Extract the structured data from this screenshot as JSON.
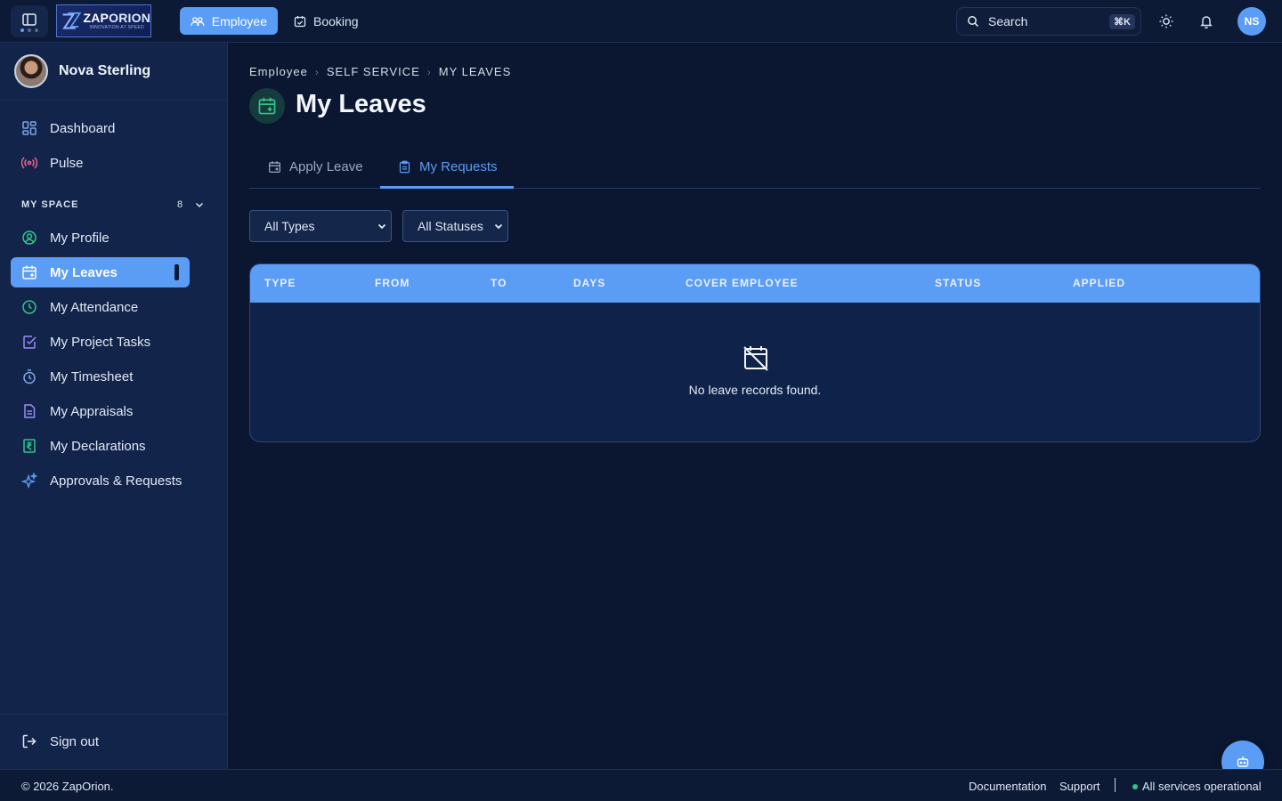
{
  "header": {
    "logo": {
      "name_bold": "ZAP",
      "name_rest": "ORION",
      "tagline": "INNOVATION AT SPEED"
    },
    "nav_tabs": [
      {
        "label": "Employee",
        "icon": "users-icon",
        "active": true
      },
      {
        "label": "Booking",
        "icon": "calendar-check-icon",
        "active": false
      }
    ],
    "search": {
      "placeholder": "Search",
      "shortcut": "⌘K"
    },
    "user_initials": "NS"
  },
  "sidebar": {
    "user_name": "Nova Sterling",
    "items": [
      {
        "label": "Dashboard",
        "icon": "dashboard-icon"
      },
      {
        "label": "Pulse",
        "icon": "broadcast-icon"
      }
    ],
    "section": {
      "label": "MY SPACE",
      "count": "8"
    },
    "space_items": [
      {
        "label": "My Profile",
        "icon": "user-circle-icon"
      },
      {
        "label": "My Leaves",
        "icon": "calendar-plus-icon",
        "active": true
      },
      {
        "label": "My Attendance",
        "icon": "clock-icon"
      },
      {
        "label": "My Project Tasks",
        "icon": "check-square-icon"
      },
      {
        "label": "My Timesheet",
        "icon": "timer-icon"
      },
      {
        "label": "My Appraisals",
        "icon": "document-icon"
      },
      {
        "label": "My Declarations",
        "icon": "rupee-receipt-icon"
      },
      {
        "label": "Approvals & Requests",
        "icon": "sparkles-icon"
      }
    ],
    "sign_out": "Sign out"
  },
  "main": {
    "breadcrumb": [
      "Employee",
      "SELF SERVICE",
      "MY LEAVES"
    ],
    "title": "My Leaves",
    "tabs": [
      {
        "label": "Apply Leave",
        "icon": "calendar-plus-icon",
        "active": false
      },
      {
        "label": "My Requests",
        "icon": "clipboard-icon",
        "active": true
      }
    ],
    "filters": {
      "type": "All Types",
      "status": "All Statuses"
    },
    "table": {
      "columns": [
        "TYPE",
        "FROM",
        "TO",
        "DAYS",
        "COVER EMPLOYEE",
        "STATUS",
        "APPLIED"
      ],
      "rows": [],
      "empty_message": "No leave records found."
    }
  },
  "footer": {
    "copyright": "© 2026 ZapOrion.",
    "links": [
      "Documentation",
      "Support"
    ],
    "status": "All services operational"
  },
  "colors": {
    "accent": "#5b9cf5",
    "background": "#0b1630",
    "sidebar": "#13244a",
    "success": "#2fc58a",
    "pulse": "#f2658e",
    "violet": "#9b8cf5"
  }
}
